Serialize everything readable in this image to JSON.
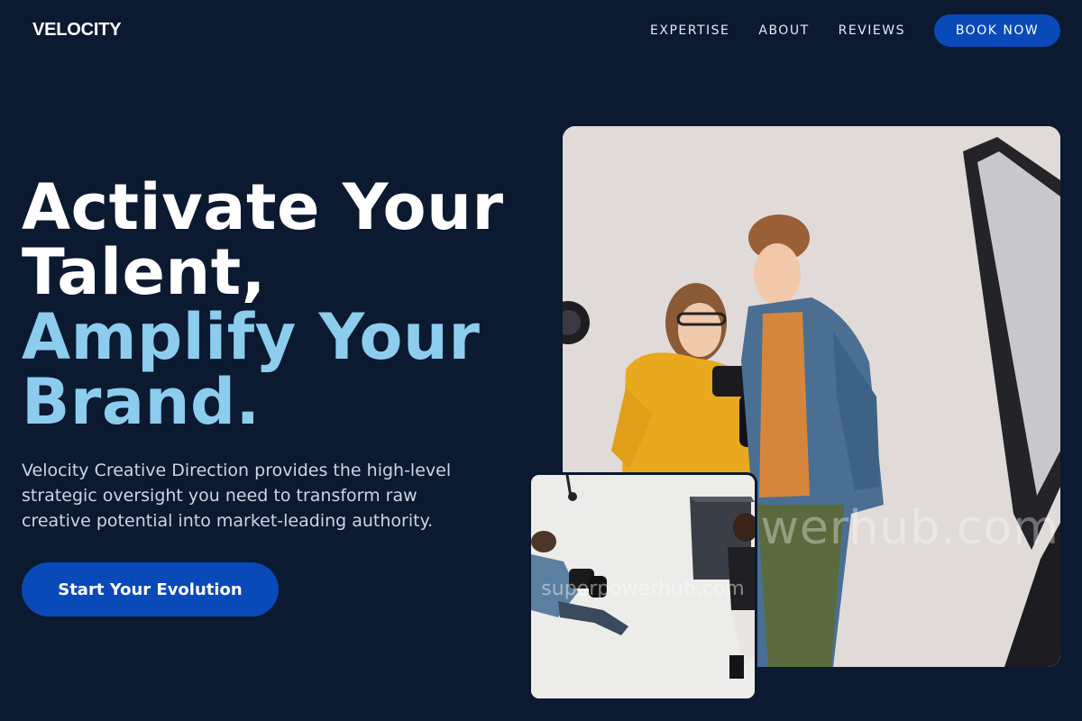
{
  "header": {
    "logo": "VELOCITY",
    "nav": [
      {
        "label": "EXPERTISE"
      },
      {
        "label": "ABOUT"
      },
      {
        "label": "REVIEWS"
      }
    ],
    "book_button": "BOOK NOW"
  },
  "hero": {
    "headline_white": [
      "Activate Your",
      "Talent,"
    ],
    "headline_accent": [
      "Amplify Your",
      "Brand."
    ],
    "subtext": "Velocity Creative Direction provides the high-level strategic oversight you need to transform raw creative potential into market-leading authority.",
    "cta": "Start Your Evolution"
  },
  "images": {
    "main_watermark": "superpowerhub.com",
    "overlay_watermark": "superpowerhub.com"
  },
  "colors": {
    "background": "#0b1931",
    "accent_blue": "#0a49b8",
    "headline_accent": "#8ccdee"
  }
}
